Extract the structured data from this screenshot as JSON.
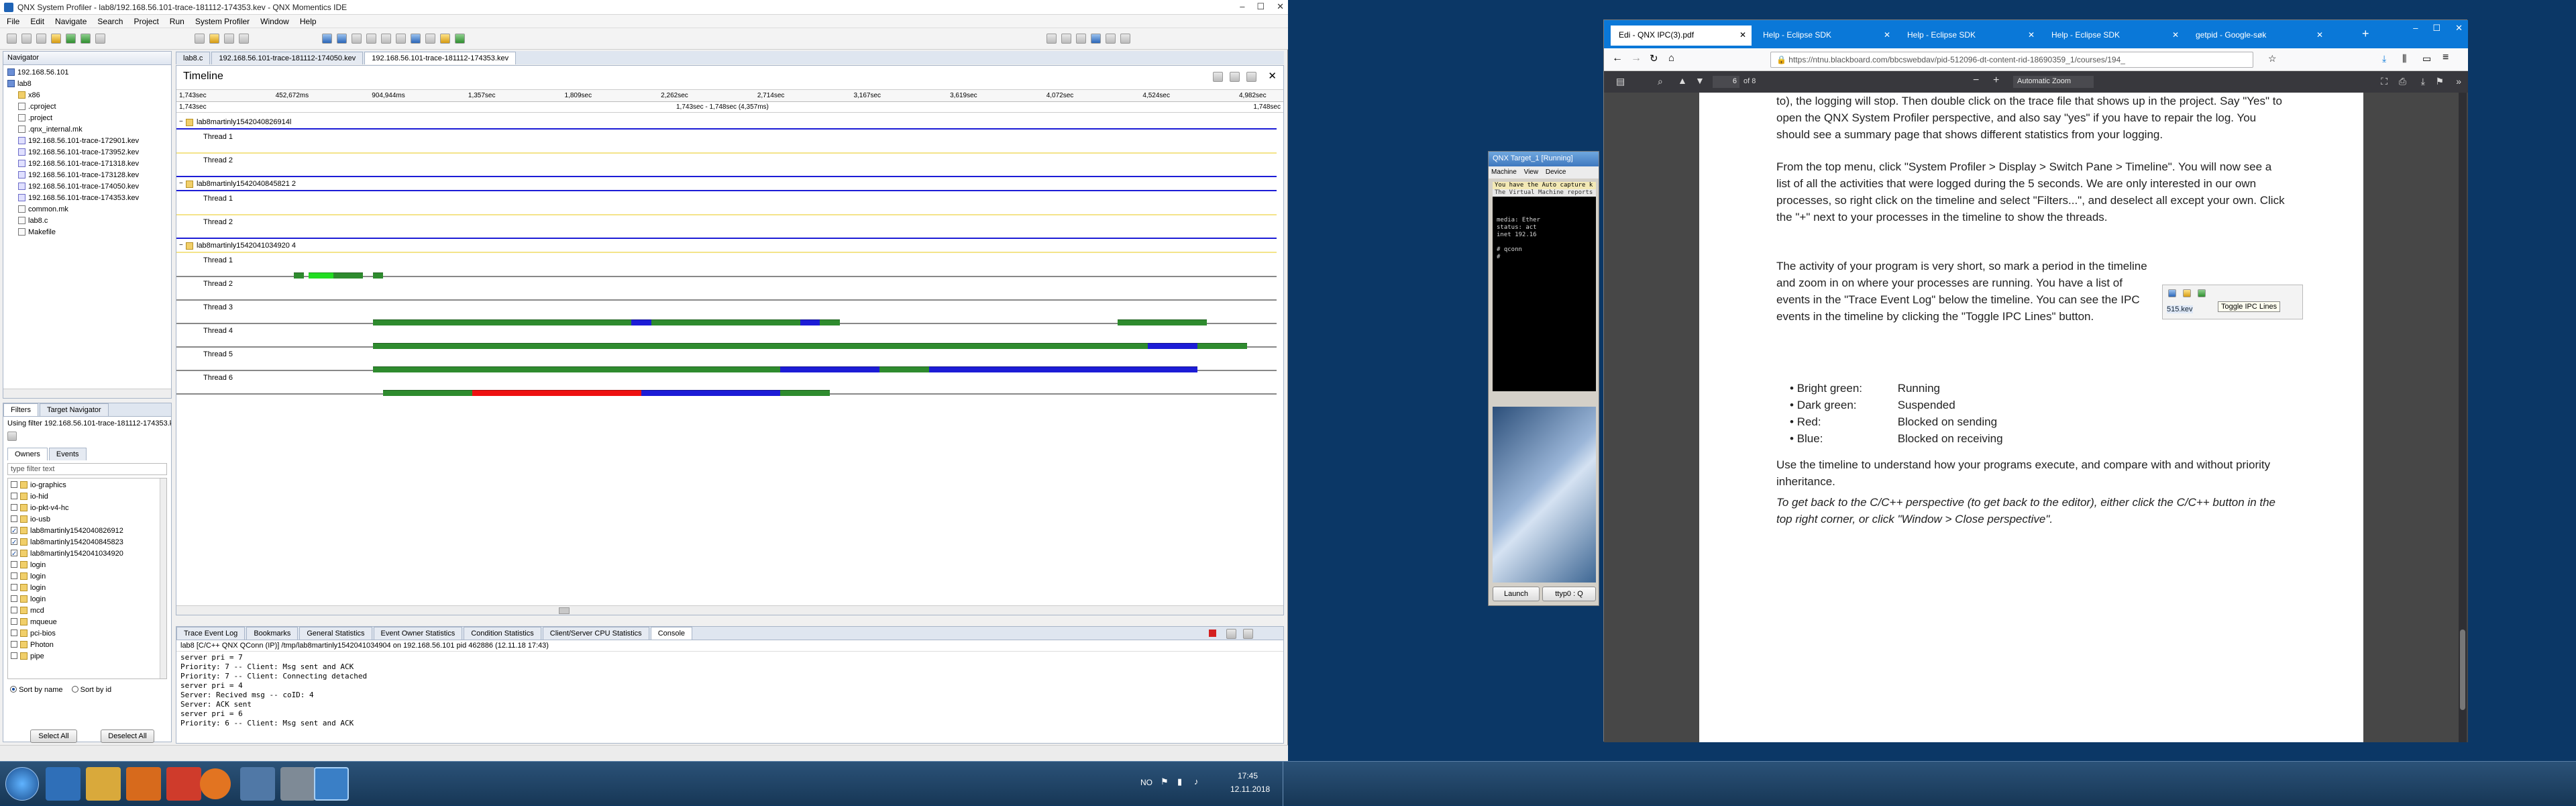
{
  "ide": {
    "title": "QNX System Profiler - lab8/192.168.56.101-trace-181112-174353.kev - QNX Momentics IDE",
    "menu": [
      "File",
      "Edit",
      "Navigate",
      "Search",
      "Project",
      "Run",
      "System Profiler",
      "Window",
      "Help"
    ],
    "editor_tabs": [
      "lab8.c",
      "192.168.56.101-trace-181112-174050.kev",
      "192.168.56.101-trace-181112-174353.kev"
    ],
    "navigator": {
      "title": "Navigator",
      "items": [
        {
          "label": "192.168.56.101",
          "indent": 0,
          "icon": "proj"
        },
        {
          "label": "lab8",
          "indent": 0,
          "icon": "proj"
        },
        {
          "label": "x86",
          "indent": 2,
          "icon": "folder"
        },
        {
          "label": ".cproject",
          "indent": 2,
          "icon": "file"
        },
        {
          "label": ".project",
          "indent": 2,
          "icon": "file"
        },
        {
          "label": ".qnx_internal.mk",
          "indent": 2,
          "icon": "file"
        },
        {
          "label": "192.168.56.101-trace-172901.kev",
          "indent": 2,
          "icon": "trace"
        },
        {
          "label": "192.168.56.101-trace-173952.kev",
          "indent": 2,
          "icon": "trace"
        },
        {
          "label": "192.168.56.101-trace-171318.kev",
          "indent": 2,
          "icon": "trace"
        },
        {
          "label": "192.168.56.101-trace-173128.kev",
          "indent": 2,
          "icon": "trace"
        },
        {
          "label": "192.168.56.101-trace-174050.kev",
          "indent": 2,
          "icon": "trace"
        },
        {
          "label": "192.168.56.101-trace-174353.kev",
          "indent": 2,
          "icon": "trace"
        },
        {
          "label": "common.mk",
          "indent": 2,
          "icon": "file"
        },
        {
          "label": "lab8.c",
          "indent": 2,
          "icon": "file"
        },
        {
          "label": "Makefile",
          "indent": 2,
          "icon": "file"
        }
      ]
    },
    "filters": {
      "tab1": "Filters",
      "tab2": "Target Navigator",
      "using": "Using filter 192.168.56.101-trace-181112-174353.kev",
      "sub_tabs": [
        "Owners",
        "Events"
      ],
      "placeholder": "type filter text",
      "items": [
        {
          "label": "io-graphics",
          "checked": false
        },
        {
          "label": "io-hid",
          "checked": false
        },
        {
          "label": "io-pkt-v4-hc",
          "checked": false
        },
        {
          "label": "io-usb",
          "checked": false
        },
        {
          "label": "lab8martinly1542040826912",
          "checked": true
        },
        {
          "label": "lab8martinly1542040845823",
          "checked": true
        },
        {
          "label": "lab8martinly1542041034920",
          "checked": true
        },
        {
          "label": "login",
          "checked": false
        },
        {
          "label": "login",
          "checked": false
        },
        {
          "label": "login",
          "checked": false
        },
        {
          "label": "login",
          "checked": false
        },
        {
          "label": "mcd",
          "checked": false
        },
        {
          "label": "mqueue",
          "checked": false
        },
        {
          "label": "pci-bios",
          "checked": false
        },
        {
          "label": "Photon",
          "checked": false
        },
        {
          "label": "pipe",
          "checked": false
        }
      ],
      "sort_name": "Sort by name",
      "sort_id": "Sort by id",
      "select_all": "Select All",
      "deselect_all": "Deselect All"
    },
    "timeline": {
      "title": "Timeline",
      "ruler_ticks": [
        "1,743sec",
        "452,672ms",
        "904,944ms",
        "1,357sec",
        "1,809sec",
        "2,262sec",
        "2,714sec",
        "3,167sec",
        "3,619sec",
        "4,072sec",
        "4,524sec",
        "4,982sec"
      ],
      "range_left": "1,743sec",
      "range_mid": "1,743sec - 1,748sec (4,357ms)",
      "range_right": "1,748sec",
      "processes": [
        {
          "name": "lab8martinly1542040826914l",
          "threads": [
            "Thread 1",
            "Thread 2"
          ]
        },
        {
          "name": "lab8martinly1542040845821 2",
          "threads": [
            "Thread 1",
            "Thread 2"
          ]
        },
        {
          "name": "lab8martinly1542041034920 4",
          "threads": [
            "Thread 1",
            "Thread 2",
            "Thread 3",
            "Thread 4",
            "Thread 5",
            "Thread 6"
          ]
        }
      ]
    },
    "bottom_tabs": [
      "Trace Event Log",
      "Bookmarks",
      "General Statistics",
      "Event Owner Statistics",
      "Condition Statistics",
      "Client/Server CPU Statistics",
      "Console"
    ],
    "console_header": "lab8 [C/C++ QNX QConn (IP)] /tmp/lab8martinly1542041034904 on 192.168.56.101 pid 462886 (12.11.18 17:43)",
    "console_lines": [
      "server pri = 7",
      "Priority: 7 -- Client: Msg sent and ACK",
      "Priority: 7 -- Client: Connecting detached",
      "server pri = 4",
      "Server: Recived msg -- coID: 4",
      "Server: ACK sent",
      "server pri = 6",
      "Priority: 6 -- Client: Msg sent and ACK"
    ]
  },
  "taskbar": {
    "lang": "NO",
    "time": "17:45",
    "date": "12.11.2018"
  },
  "vm": {
    "title": "QNX Target_1 [Running]",
    "menu": [
      "Machine",
      "View",
      "Device"
    ],
    "banner": "You have the Auto capture k",
    "banner2": "The Virtual Machine reports tha",
    "terminal": [
      "media: Ether",
      "status: act",
      "inet 192.16",
      "",
      "# qconn",
      "#"
    ],
    "launch": "Launch",
    "term_btn": "ttyp0 : Q"
  },
  "browser": {
    "tabs": [
      "Edi - QNX IPC(3).pdf",
      "Help - Eclipse SDK",
      "Help - Eclipse SDK",
      "Help - Eclipse SDK",
      "getpid - Google-søk"
    ],
    "url": "https://ntnu.blackboard.com/bbcswebdav/pid-512096-dt-content-rid-18690359_1/courses/194_",
    "page_num": "6",
    "page_total": "of 8",
    "zoom": "Automatic Zoom",
    "pdf": {
      "p1": "to), the logging will stop. Then double click on the trace file that shows up in the project. Say \"Yes\" to open the QNX System Profiler perspective, and also say \"yes\" if you have to repair the log. You should see a summary page that shows different statistics from your logging.",
      "p2": "From the top menu, click \"System Profiler > Display > Switch Pane > Timeline\". You will now see a list of all the activities that were logged during the 5 seconds. We are only interested in our own processes, so right click on the timeline and select \"Filters...\", and deselect all except your own. Click the \"+\" next to your processes in the timeline to show the threads.",
      "p3": "The activity of your program is very short, so mark a period in the timeline and zoom in on where your processes are running. You have a list of events in the \"Trace Event Log\" below the timeline. You can see the IPC events in the timeline by clicking the \"Toggle IPC Lines\" button.",
      "tooltip": "Toggle IPC Lines",
      "tooltip_file": "515.kev",
      "legend": [
        {
          "color": "Bright green:",
          "meaning": "Running"
        },
        {
          "color": "Dark green:",
          "meaning": "Suspended"
        },
        {
          "color": "Red:",
          "meaning": "Blocked on sending"
        },
        {
          "color": "Blue:",
          "meaning": "Blocked on receiving"
        }
      ],
      "p4": "Use the timeline to understand how your programs execute, and compare with and without priority inheritance.",
      "p5": "To get back to the C/C++ perspective (to get back to the editor), either click the C/C++ button in the top right corner, or click \"Window > Close perspective\"."
    }
  },
  "colors": {
    "running": "#22dd22",
    "suspended": "#2e8b2e",
    "blocked_send": "#ee1111",
    "blocked_receive": "#1c1cd6",
    "idle_line": "#f0e68c",
    "accent": "#0a78d8"
  }
}
